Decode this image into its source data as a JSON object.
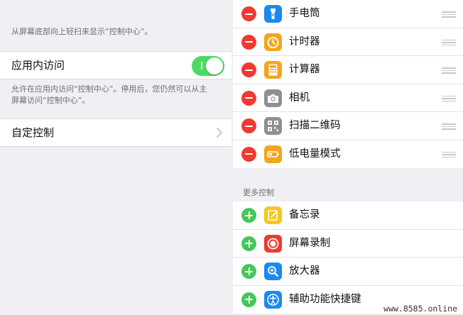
{
  "left": {
    "top_note": "从屏幕底部向上轻扫来显示“控制中心”。",
    "in_app_access": {
      "label": "应用内访问",
      "toggle_on": true,
      "accent": "#4cd964"
    },
    "in_app_note_line1": "允许在应用内访问“控制中心”。停用后，您仍然可以从主",
    "in_app_note_line2": "屏幕访问“控制中心”。",
    "customize": {
      "label": "自定控制"
    }
  },
  "right": {
    "included": [
      {
        "label": "手电筒",
        "icon": "flashlight-icon",
        "color": "#1a8af0"
      },
      {
        "label": "计时器",
        "icon": "timer-icon",
        "color": "#f6a41c"
      },
      {
        "label": "计算器",
        "icon": "calculator-icon",
        "color": "#f6a41c"
      },
      {
        "label": "相机",
        "icon": "camera-icon",
        "color": "#8e8e93"
      },
      {
        "label": "扫描二维码",
        "icon": "qr-code-icon",
        "color": "#8e8e93"
      },
      {
        "label": "低电量模式",
        "icon": "battery-icon",
        "color": "#f6a41c"
      }
    ],
    "more_header": "更多控制",
    "more": [
      {
        "label": "备忘录",
        "icon": "notes-icon",
        "color": "#f7c81c"
      },
      {
        "label": "屏幕录制",
        "icon": "screen-record-icon",
        "color": "#ee3a32"
      },
      {
        "label": "放大器",
        "icon": "magnifier-icon",
        "color": "#1a8af0"
      },
      {
        "label": "辅助功能快捷键",
        "icon": "accessibility-icon",
        "color": "#1a8af0"
      }
    ],
    "remove_color": "#ee3a32",
    "add_color": "#47c55a"
  },
  "watermark": "www.8585.online"
}
